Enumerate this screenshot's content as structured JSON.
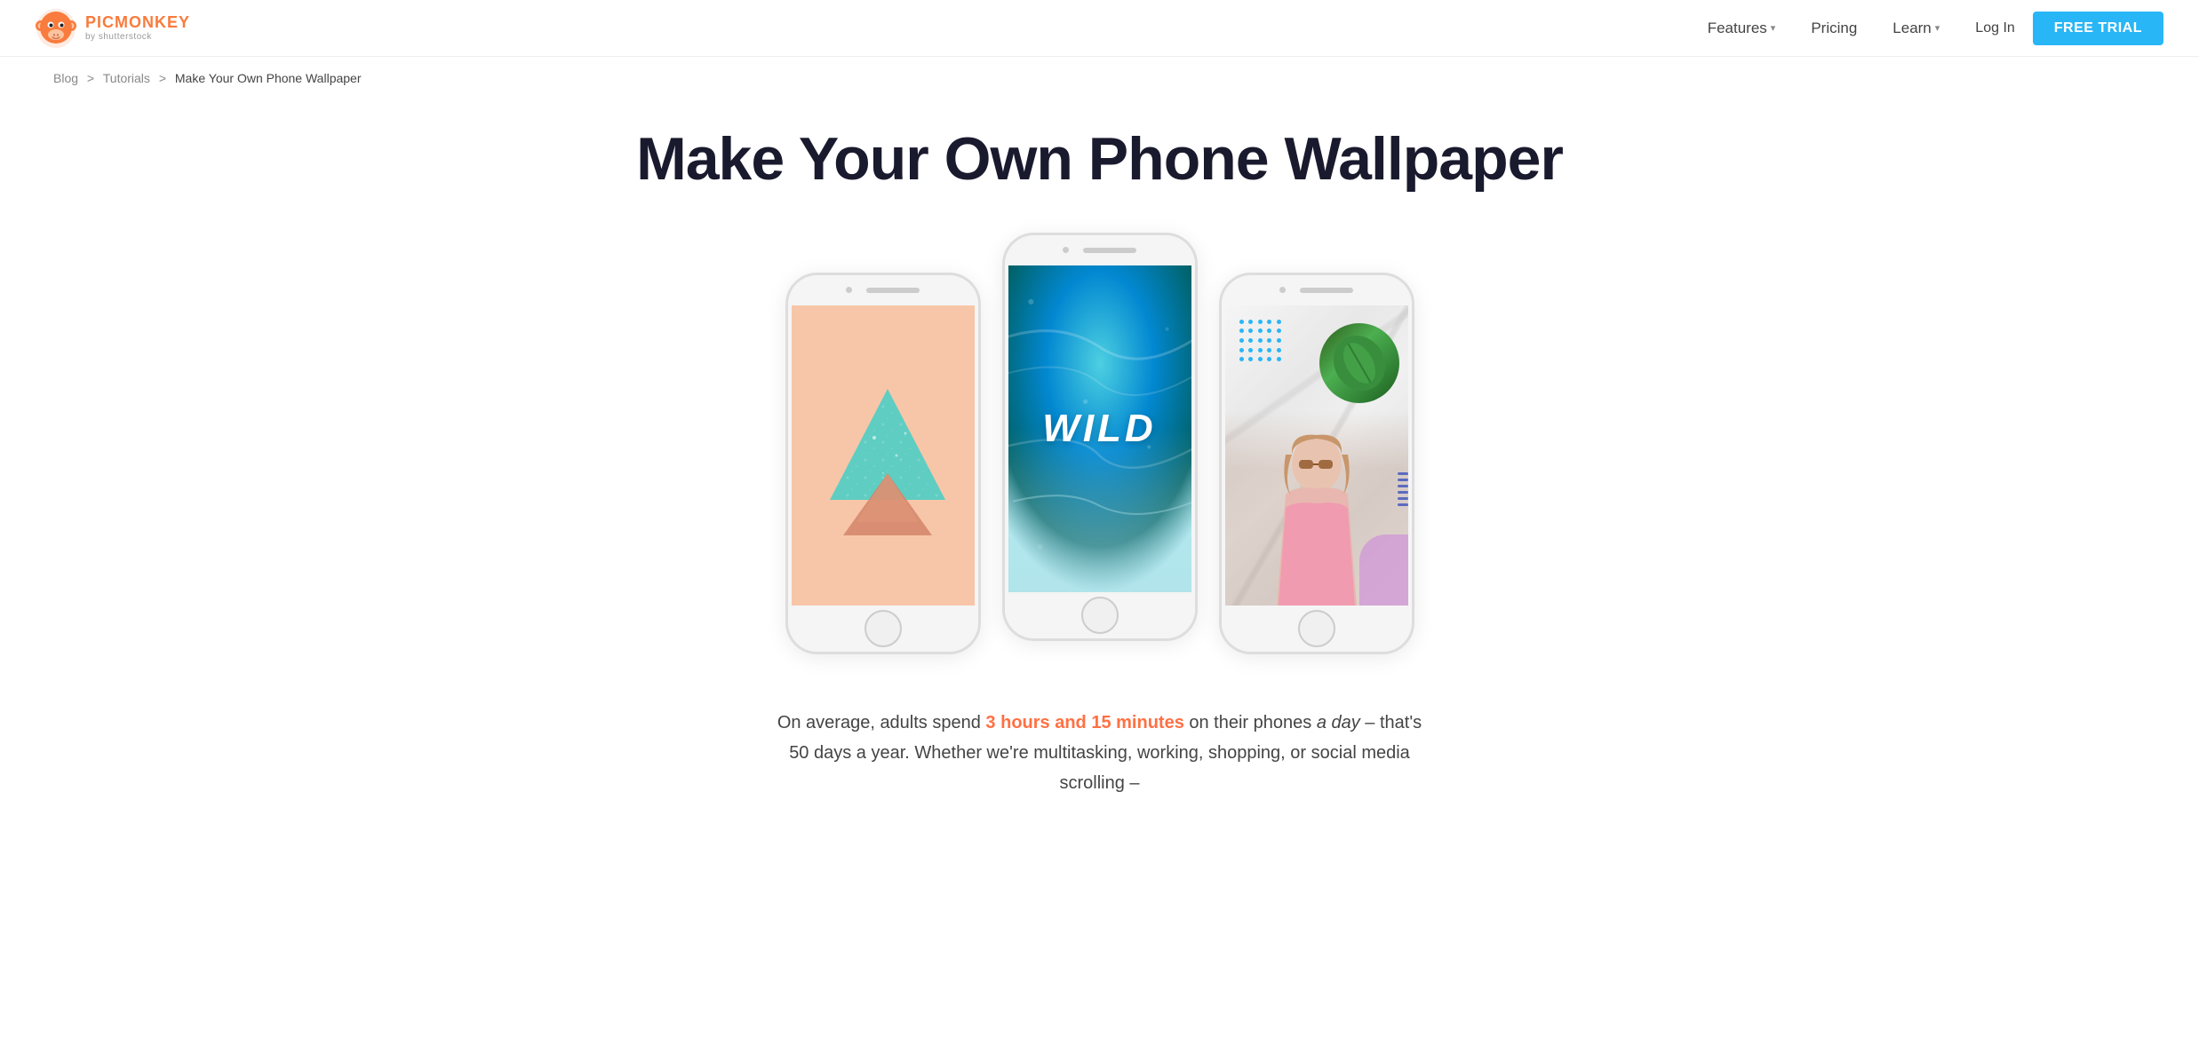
{
  "brand": {
    "name": "PICMONKEY",
    "tagline": "by shutterstock"
  },
  "nav": {
    "features_label": "Features",
    "pricing_label": "Pricing",
    "learn_label": "Learn",
    "login_label": "Log In",
    "free_trial_label": "FREE TRIAL"
  },
  "breadcrumb": {
    "blog": "Blog",
    "tutorials": "Tutorials",
    "current": "Make Your Own Phone Wallpaper",
    "sep1": ">",
    "sep2": ">"
  },
  "hero": {
    "title": "Make Your Own Phone Wallpaper"
  },
  "phones": [
    {
      "id": "phone-1",
      "type": "triangle-design"
    },
    {
      "id": "phone-2",
      "type": "wild-text"
    },
    {
      "id": "phone-3",
      "type": "photo-collage"
    }
  ],
  "body": {
    "part1": "On average, adults spend ",
    "highlight": "3 hours and 15 minutes",
    "part2": " on their phones ",
    "italic": "a day",
    "part3": " – that's 50 days a year. Whether we're multitasking, working, shopping, or social media scrolling –"
  },
  "wild_text": "WILD",
  "dots": [
    1,
    2,
    3,
    4,
    5,
    6,
    7,
    8,
    9,
    10,
    11,
    12,
    13,
    14,
    15,
    16,
    17,
    18,
    19,
    20,
    21,
    22,
    23,
    24,
    25
  ]
}
